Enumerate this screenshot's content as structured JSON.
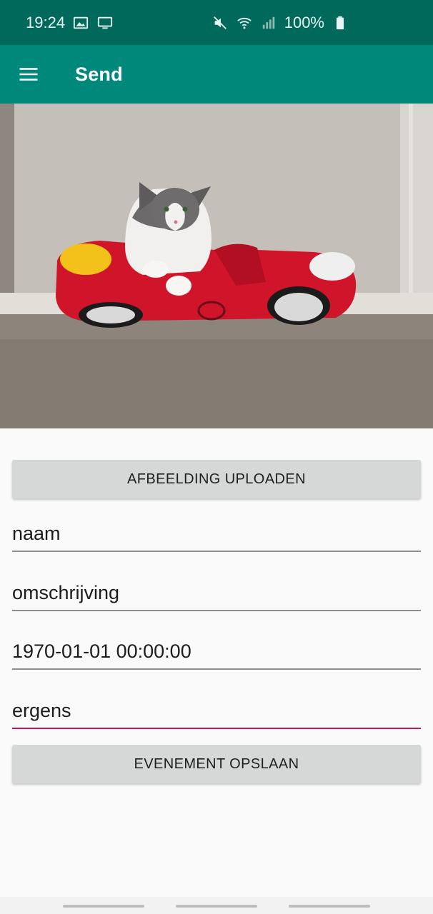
{
  "status_bar": {
    "time": "19:24",
    "battery_text": "100%",
    "icons": [
      "image-icon",
      "cast-icon",
      "mute-icon",
      "wifi-icon",
      "signal-icon",
      "battery-icon"
    ]
  },
  "app_bar": {
    "title": "Send",
    "menu_icon": "hamburger-menu-icon"
  },
  "hero_image": {
    "subject": "cat"
  },
  "form": {
    "upload_button": "AFBEELDING UPLOADEN",
    "fields": {
      "naam": "naam",
      "omschrijving": "omschrijving",
      "datum": "1970-01-01 00:00:00",
      "locatie": "ergens"
    },
    "save_button": "EVENEMENT OPSLAAN"
  },
  "colors": {
    "status_bar": "#00695c",
    "app_bar": "#00897b",
    "accent_underline": "#c2185b"
  }
}
